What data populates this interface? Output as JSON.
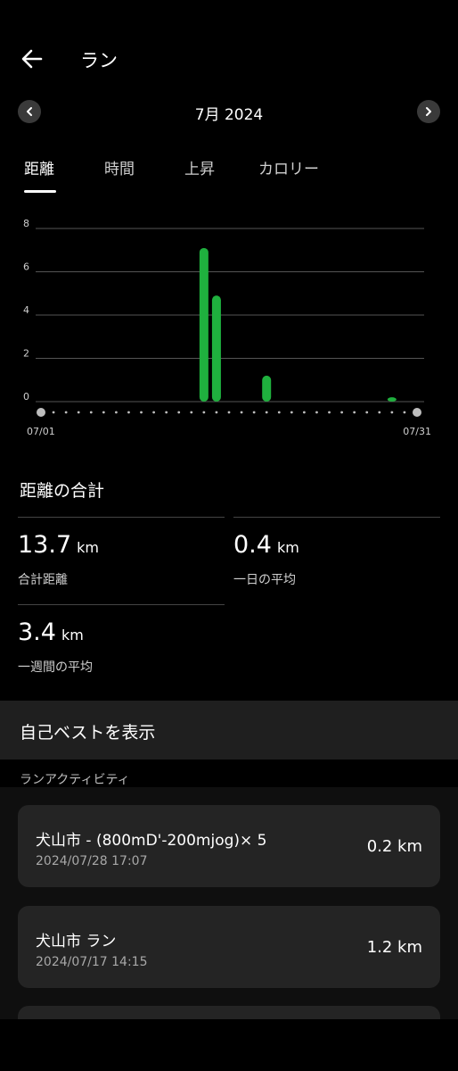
{
  "header": {
    "title": "ラン"
  },
  "month_selector": {
    "label": "7月 2024"
  },
  "tabs": [
    {
      "label": "距離",
      "active": true
    },
    {
      "label": "時間",
      "active": false
    },
    {
      "label": "上昇",
      "active": false
    },
    {
      "label": "カロリー",
      "active": false
    }
  ],
  "chart_data": {
    "type": "bar",
    "x_start_label": "07/01",
    "x_end_label": "07/31",
    "y_ticks": [
      "0",
      "2",
      "4",
      "6",
      "8"
    ],
    "ylim": [
      0,
      8
    ],
    "days": 31,
    "bars": [
      {
        "day": 14,
        "value": 7.1
      },
      {
        "day": 15,
        "value": 4.9
      },
      {
        "day": 19,
        "value": 1.2
      },
      {
        "day": 29,
        "value": 0.2
      }
    ],
    "bar_color": "#1fb03e",
    "grid": true
  },
  "summary": {
    "title": "距離の合計",
    "stats": [
      {
        "value": "13.7",
        "unit": "km",
        "label": "合計距離"
      },
      {
        "value": "0.4",
        "unit": "km",
        "label": "一日の平均"
      },
      {
        "value": "3.4",
        "unit": "km",
        "label": "一週間の平均"
      }
    ]
  },
  "personal_best": {
    "label": "自己ベストを表示"
  },
  "activities": {
    "section_label": "ランアクティビティ",
    "items": [
      {
        "title": "犬山市 - (800mD'-200mjog)× 5",
        "date": "2024/07/28 17:07",
        "distance": "0.2 km"
      },
      {
        "title": "犬山市 ラン",
        "date": "2024/07/17 14:15",
        "distance": "1.2 km"
      }
    ]
  }
}
